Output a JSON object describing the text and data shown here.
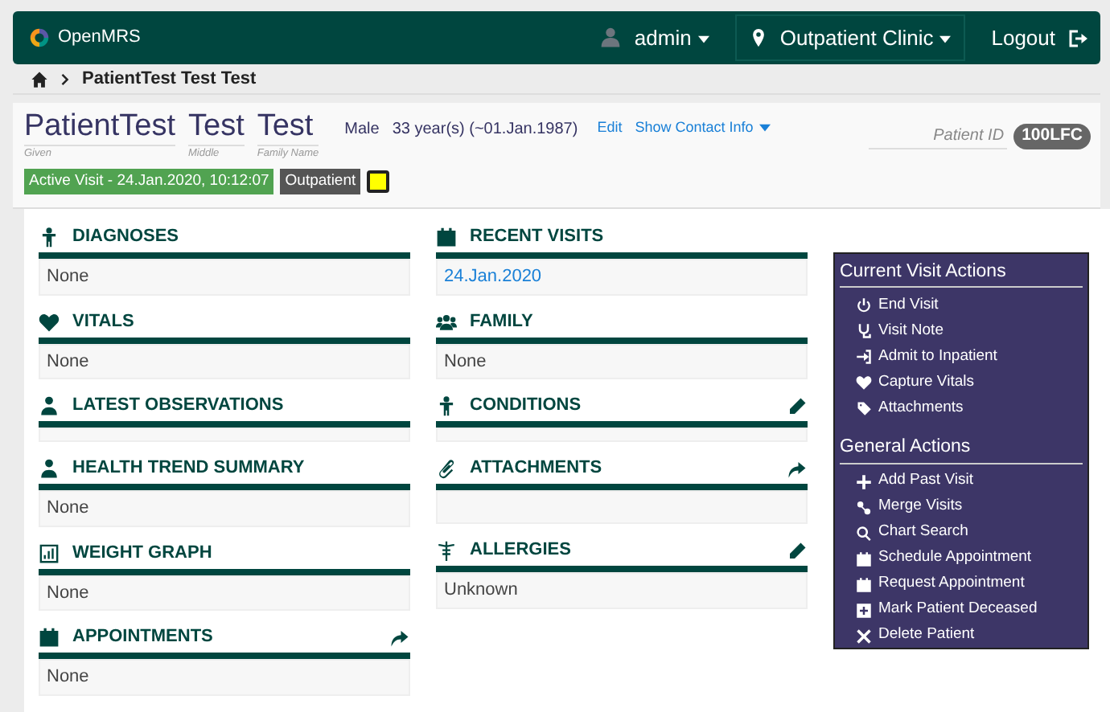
{
  "header": {
    "logo_text": "OpenMRS",
    "user": "admin",
    "location": "Outpatient Clinic",
    "logout": "Logout"
  },
  "breadcrumb": {
    "current": "PatientTest Test Test"
  },
  "patient": {
    "names": [
      {
        "value": "PatientTest",
        "label": "Given"
      },
      {
        "value": "Test",
        "label": "Middle"
      },
      {
        "value": "Test",
        "label": "Family Name"
      }
    ],
    "gender": "Male",
    "age": "33 year(s) (~01.Jan.1987)",
    "edit": "Edit",
    "contact": "Show Contact Info",
    "id_label": "Patient ID",
    "id": "100LFC",
    "visit": "Active Visit - 24.Jan.2020, 10:12:07",
    "visit_type": "Outpatient"
  },
  "columns": [
    [
      {
        "title": "DIAGNOSES",
        "body": "None"
      },
      {
        "title": "VITALS",
        "body": "None"
      },
      {
        "title": "LATEST OBSERVATIONS"
      },
      {
        "title": "HEALTH TREND SUMMARY",
        "body": "None"
      },
      {
        "title": "WEIGHT GRAPH",
        "body": "None"
      },
      {
        "title": "APPOINTMENTS",
        "body": "None"
      }
    ],
    [
      {
        "title": "RECENT VISITS",
        "body": "24.Jan.2020",
        "kind": "link"
      },
      {
        "title": "FAMILY",
        "body": "None"
      },
      {
        "title": "CONDITIONS"
      },
      {
        "title": "ATTACHMENTS",
        "tall": true
      },
      {
        "title": "ALLERGIES",
        "body": "Unknown"
      }
    ]
  ],
  "actions": [
    {
      "title": "Current Visit Actions",
      "items": [
        "End Visit",
        "Visit Note",
        "Admit to Inpatient",
        "Capture Vitals",
        "Attachments"
      ]
    },
    {
      "title": "General Actions",
      "items": [
        "Add Past Visit",
        "Merge Visits",
        "Chart Search",
        "Schedule Appointment",
        "Request Appointment",
        "Mark Patient Deceased",
        "Delete Patient"
      ]
    }
  ]
}
